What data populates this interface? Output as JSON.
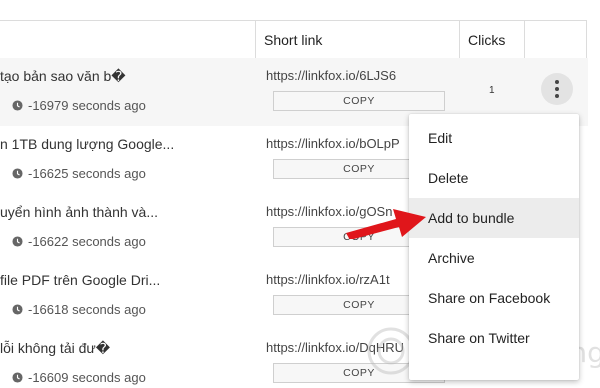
{
  "header": {
    "short_link": "Short link",
    "clicks": "Clicks"
  },
  "rows": [
    {
      "title": "tạo bản sao văn b�",
      "time": "-16979 seconds ago",
      "short": "https://linkfox.io/6LJS6",
      "copy": "COPY",
      "clicks": "1"
    },
    {
      "title": "n 1TB dung lượng Google...",
      "time": "-16625 seconds ago",
      "short": "https://linkfox.io/bOLpP",
      "copy": "COPY",
      "clicks": ""
    },
    {
      "title": "uyển hình ảnh thành và...",
      "time": "-16622 seconds ago",
      "short": "https://linkfox.io/gOSn",
      "copy": "COPY",
      "clicks": ""
    },
    {
      "title": "file PDF trên Google Dri...",
      "time": "-16618 seconds ago",
      "short": "https://linkfox.io/rzA1t",
      "copy": "COPY",
      "clicks": ""
    },
    {
      "title": "lỗi không tải đư�",
      "time": "-16609 seconds ago",
      "short": "https://linkfox.io/DqHRU",
      "copy": "COPY",
      "clicks": ""
    }
  ],
  "menu": {
    "items": [
      "Edit",
      "Delete",
      "Add to bundle",
      "Archive",
      "Share on Facebook",
      "Share on Twitter"
    ]
  },
  "colors": {
    "arrow": "#e0161b",
    "menu_active_bg": "#ececec",
    "selected_row_bg": "#f6f6f6"
  },
  "icons": {
    "clock": "clock-icon",
    "kebab": "more-vert-icon",
    "arrow": "red-pointer-arrow",
    "watermark": "watermark-logo"
  }
}
